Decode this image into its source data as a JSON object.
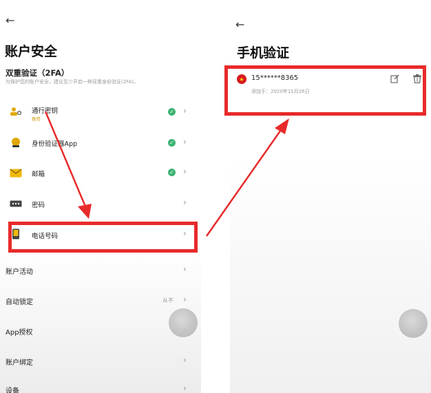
{
  "left": {
    "back": "←",
    "title": "账户安全",
    "section_title": "双重验证（2FA）",
    "section_desc": "为保护您的账户安全，建议至少开启一种双重身份验证(2FA)。",
    "items": [
      {
        "label": "通行密钥",
        "sub": "推荐",
        "icon": "passkey-icon",
        "enabled": true
      },
      {
        "label": "身份验证器App",
        "icon": "authenticator-icon",
        "enabled": true
      },
      {
        "label": "邮箱",
        "icon": "email-icon",
        "enabled": true
      },
      {
        "label": "密码",
        "icon": "password-icon",
        "enabled": false
      },
      {
        "label": "电话号码",
        "icon": "phone-icon",
        "enabled": false
      }
    ],
    "other_items": [
      {
        "label": "账户活动"
      },
      {
        "label": "自动锁定",
        "value": "从不"
      },
      {
        "label": "App授权"
      },
      {
        "label": "账户绑定"
      },
      {
        "label": "设备"
      }
    ],
    "chevron": "›",
    "check": "✓"
  },
  "right": {
    "back": "←",
    "title": "手机验证",
    "phone": "15******8365",
    "added": "添加于：2020年11月26日"
  },
  "colors": {
    "highlight": "#e82a2a",
    "check": "#3cb371",
    "flag": "#d71920"
  }
}
